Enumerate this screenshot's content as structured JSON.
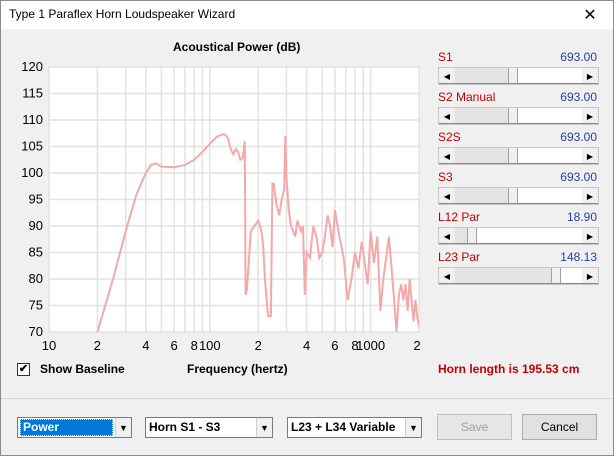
{
  "window": {
    "title": "Type 1 Paraflex Horn Loudspeaker Wizard",
    "close_glyph": "✕"
  },
  "chart_data": {
    "type": "line",
    "title": "Acoustical Power (dB)",
    "xlabel": "Frequency (hertz)",
    "ylabel": "",
    "x_scale": "log",
    "xlim": [
      10,
      2000
    ],
    "ylim": [
      70,
      120
    ],
    "yticks": [
      "70",
      "75",
      "80",
      "85",
      "90",
      "95",
      "100",
      "105",
      "110",
      "115",
      "120"
    ],
    "xticks": [
      "10",
      "2",
      "4",
      "6",
      "8",
      "100",
      "2",
      "4",
      "6",
      "8",
      "1000",
      "2"
    ],
    "grid": true,
    "line_color": "#f4a9a9",
    "series": [
      {
        "x": [
          20,
          25,
          30,
          35,
          40,
          43,
          46,
          50,
          60,
          70,
          80,
          90,
          100,
          110,
          120,
          125,
          130,
          135,
          140,
          145,
          150,
          155,
          160,
          165,
          167,
          170,
          180,
          200,
          210,
          215,
          220,
          230,
          240,
          245,
          250,
          260,
          270,
          280,
          290,
          295,
          300,
          310,
          320,
          330,
          340,
          350,
          360,
          370,
          380,
          390,
          400,
          420,
          440,
          460,
          480,
          500,
          520,
          540,
          560,
          580,
          600,
          640,
          680,
          720,
          760,
          800,
          840,
          880,
          920,
          960,
          1000,
          1050,
          1100,
          1150,
          1200,
          1250,
          1300,
          1350,
          1400,
          1450,
          1500,
          1550,
          1600,
          1650,
          1700,
          1750,
          1800,
          1850,
          1900,
          1950,
          2000
        ],
        "y": [
          70,
          80,
          89,
          96,
          100,
          101.5,
          101.8,
          101.2,
          101.1,
          101.5,
          102.5,
          104,
          105.5,
          106.8,
          107.3,
          107.2,
          106.5,
          104.5,
          103.5,
          104.5,
          104,
          102.5,
          102.8,
          106,
          77,
          78,
          89,
          91,
          89,
          86,
          80,
          73,
          73,
          98,
          98,
          94,
          92,
          95,
          97,
          107,
          99,
          93,
          90,
          89,
          88,
          91,
          90,
          89,
          90,
          77,
          85,
          84,
          90,
          88,
          84,
          85,
          88,
          92,
          90,
          86,
          93,
          88,
          84,
          76,
          80,
          85,
          82,
          87,
          83,
          79,
          89,
          83,
          88,
          74,
          80,
          84,
          88,
          82,
          76,
          70,
          77,
          79,
          76,
          79,
          74,
          80,
          76,
          72,
          76,
          73,
          71
        ]
      }
    ]
  },
  "sliders": [
    {
      "label": "S1",
      "value": "693.00",
      "position": 0.45
    },
    {
      "label": "S2  Manual",
      "value": "693.00",
      "position": 0.45
    },
    {
      "label": "S2S",
      "value": "693.00",
      "position": 0.45
    },
    {
      "label": "S3",
      "value": "693.00",
      "position": 0.45
    },
    {
      "label": "L12  Par",
      "value": "18.90",
      "position": 0.1
    },
    {
      "label": "L23  Par",
      "value": "148.13",
      "position": 0.82
    }
  ],
  "show_baseline": {
    "label": "Show Baseline",
    "checked": true,
    "check_glyph": "✔"
  },
  "horn_length": "Horn length is 195.53 cm",
  "combos": {
    "mode": "Power",
    "range": "Horn S1 - S3",
    "variable": "L23 + L34 Variable"
  },
  "buttons": {
    "save": "Save",
    "cancel": "Cancel"
  }
}
